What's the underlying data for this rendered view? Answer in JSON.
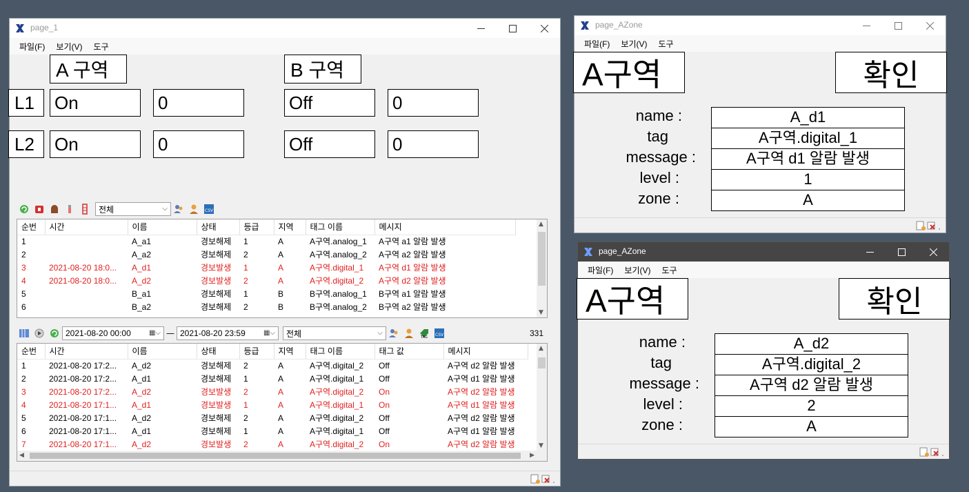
{
  "win1": {
    "title": "page_1",
    "menu": [
      "파일(F)",
      "보기(V)",
      "도구"
    ],
    "zone_a": "A 구역",
    "zone_b": "B 구역",
    "rows": [
      {
        "label": "L1",
        "a_state": "On",
        "a_val": "0",
        "b_state": "Off",
        "b_val": "0"
      },
      {
        "label": "L2",
        "a_state": "On",
        "a_val": "0",
        "b_state": "Off",
        "b_val": "0"
      }
    ],
    "alarm_grid": {
      "filter": "전체",
      "headers": [
        "순번",
        "시간",
        "이름",
        "상태",
        "등급",
        "지역",
        "태그 이름",
        "메시지"
      ],
      "rows": [
        {
          "alarm": false,
          "cells": [
            "1",
            "",
            "A_a1",
            "경보해제",
            "1",
            "A",
            "A구역.analog_1",
            "A구역 a1 알람 발생"
          ]
        },
        {
          "alarm": false,
          "cells": [
            "2",
            "",
            "A_a2",
            "경보해제",
            "2",
            "A",
            "A구역.analog_2",
            "A구역 a2 알람 발생"
          ]
        },
        {
          "alarm": true,
          "cells": [
            "3",
            "2021-08-20 18:0...",
            "A_d1",
            "경보발생",
            "1",
            "A",
            "A구역.digital_1",
            "A구역 d1 알람 발생"
          ]
        },
        {
          "alarm": true,
          "cells": [
            "4",
            "2021-08-20 18:0...",
            "A_d2",
            "경보발생",
            "2",
            "A",
            "A구역.digital_2",
            "A구역 d2 알람 발생"
          ]
        },
        {
          "alarm": false,
          "cells": [
            "5",
            "",
            "B_a1",
            "경보해제",
            "1",
            "B",
            "B구역.analog_1",
            "B구역 a1 알람 발생"
          ]
        },
        {
          "alarm": false,
          "cells": [
            "6",
            "",
            "B_a2",
            "경보해제",
            "2",
            "B",
            "B구역.analog_2",
            "B구역 a2 알람 발생"
          ]
        }
      ]
    },
    "history_grid": {
      "start": "2021-08-20 00:00",
      "end": "2021-08-20 23:59",
      "dash": "—",
      "filter": "전체",
      "count": "331",
      "headers": [
        "순번",
        "시간",
        "이름",
        "상태",
        "등급",
        "지역",
        "태그 이름",
        "태그 값",
        "메시지"
      ],
      "rows": [
        {
          "alarm": false,
          "cells": [
            "1",
            "2021-08-20 17:2...",
            "A_d2",
            "경보해제",
            "2",
            "A",
            "A구역.digital_2",
            "Off",
            "A구역 d2 알람 발생"
          ]
        },
        {
          "alarm": false,
          "cells": [
            "2",
            "2021-08-20 17:2...",
            "A_d1",
            "경보해제",
            "1",
            "A",
            "A구역.digital_1",
            "Off",
            "A구역 d1 알람 발생"
          ]
        },
        {
          "alarm": true,
          "cells": [
            "3",
            "2021-08-20 17:2...",
            "A_d2",
            "경보발생",
            "2",
            "A",
            "A구역.digital_2",
            "On",
            "A구역 d2 알람 발생"
          ]
        },
        {
          "alarm": true,
          "cells": [
            "4",
            "2021-08-20 17:1...",
            "A_d1",
            "경보발생",
            "1",
            "A",
            "A구역.digital_1",
            "On",
            "A구역 d1 알람 발생"
          ]
        },
        {
          "alarm": false,
          "cells": [
            "5",
            "2021-08-20 17:1...",
            "A_d2",
            "경보해제",
            "2",
            "A",
            "A구역.digital_2",
            "Off",
            "A구역 d2 알람 발생"
          ]
        },
        {
          "alarm": false,
          "cells": [
            "6",
            "2021-08-20 17:1...",
            "A_d1",
            "경보해제",
            "1",
            "A",
            "A구역.digital_1",
            "Off",
            "A구역 d1 알람 발생"
          ]
        },
        {
          "alarm": true,
          "cells": [
            "7",
            "2021-08-20 17:1...",
            "A_d2",
            "경보발생",
            "2",
            "A",
            "A구역.digital_2",
            "On",
            "A구역 d2 알람 발생"
          ]
        }
      ]
    }
  },
  "win2": {
    "title": "page_AZone",
    "menu": [
      "파일(F)",
      "보기(V)",
      "도구"
    ],
    "zone": "A구역",
    "confirm": "확인",
    "fields": [
      {
        "label": "name :",
        "value": "A_d1"
      },
      {
        "label": "tag",
        "value": "A구역.digital_1"
      },
      {
        "label": "message :",
        "value": "A구역 d1 알람 발생"
      },
      {
        "label": "level :",
        "value": "1"
      },
      {
        "label": "zone :",
        "value": "A"
      }
    ]
  },
  "win3": {
    "title": "page_AZone",
    "menu": [
      "파일(F)",
      "보기(V)",
      "도구"
    ],
    "zone": "A구역",
    "confirm": "확인",
    "fields": [
      {
        "label": "name :",
        "value": "A_d2"
      },
      {
        "label": "tag",
        "value": "A구역.digital_2"
      },
      {
        "label": "message :",
        "value": "A구역 d2 알람 발생"
      },
      {
        "label": "level :",
        "value": "2"
      },
      {
        "label": "zone :",
        "value": "A"
      }
    ]
  }
}
